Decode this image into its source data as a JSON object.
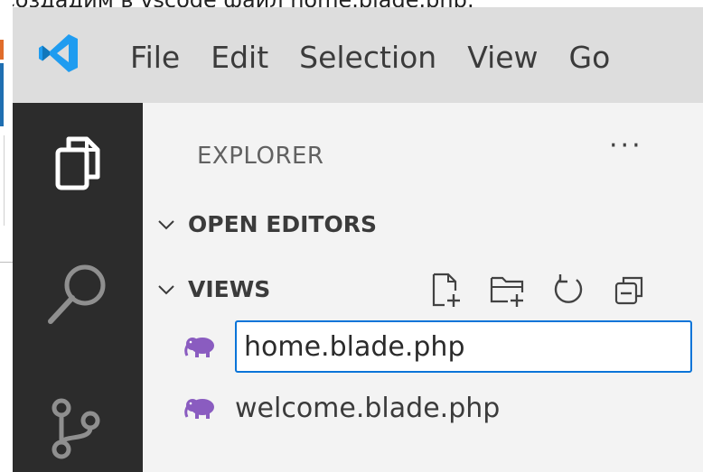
{
  "caption": "Создадим в vscode файл home.blade.php:",
  "menu": {
    "items": [
      "File",
      "Edit",
      "Selection",
      "View",
      "Go"
    ]
  },
  "explorer": {
    "title": "EXPLORER",
    "more_label": "···",
    "sections": {
      "open_editors": "OPEN EDITORS",
      "views": "VIEWS"
    },
    "views_actions": [
      "new-file-icon",
      "new-folder-icon",
      "refresh-icon",
      "collapse-all-icon"
    ],
    "rename_value": "home.blade.php",
    "files": [
      "welcome.blade.php"
    ]
  },
  "colors": {
    "titlebar": "#dddddd",
    "activitybar": "#2c2c2c",
    "sidebar": "#f3f3f3",
    "accent": "#0a74d8",
    "vscode_blue": "#1f9cf0",
    "php_purple": "#8a5cc0"
  }
}
